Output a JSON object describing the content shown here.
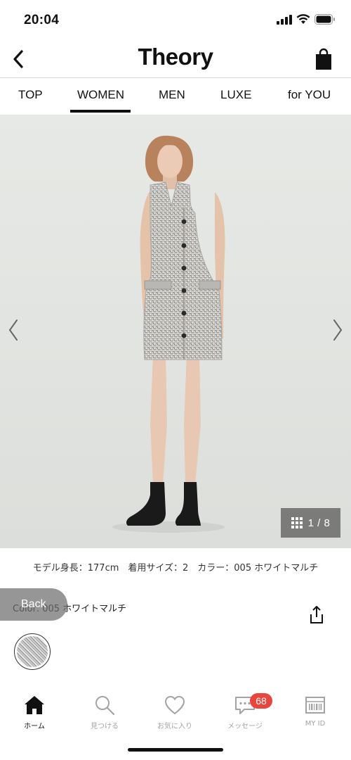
{
  "status_bar": {
    "time": "20:04"
  },
  "header": {
    "brand": "Theory"
  },
  "category_tabs": [
    {
      "label": "TOP"
    },
    {
      "label": "WOMEN"
    },
    {
      "label": "MEN"
    },
    {
      "label": "LUXE"
    },
    {
      "label": "for YOU"
    }
  ],
  "active_category": "WOMEN",
  "gallery": {
    "counter": "1 / 8",
    "current_index": 1,
    "total": 8
  },
  "product": {
    "model_info": "モデル身長：177cm　着用サイズ：2　カラー：005 ホワイトマルチ",
    "color_label": "Color: 005 ホワイトマルチ"
  },
  "back_pill": {
    "label": "Back"
  },
  "tab_bar": [
    {
      "label": "ホーム",
      "icon": "home-icon"
    },
    {
      "label": "見つける",
      "icon": "search-icon"
    },
    {
      "label": "お気に入り",
      "icon": "heart-icon"
    },
    {
      "label": "メッセージ",
      "icon": "message-icon"
    },
    {
      "label": "MY ID",
      "icon": "barcode-icon"
    }
  ],
  "messages_badge": "68",
  "colors": {
    "badge": "#e8453c",
    "accent": "#111111",
    "inactive": "#a3a3a3"
  }
}
